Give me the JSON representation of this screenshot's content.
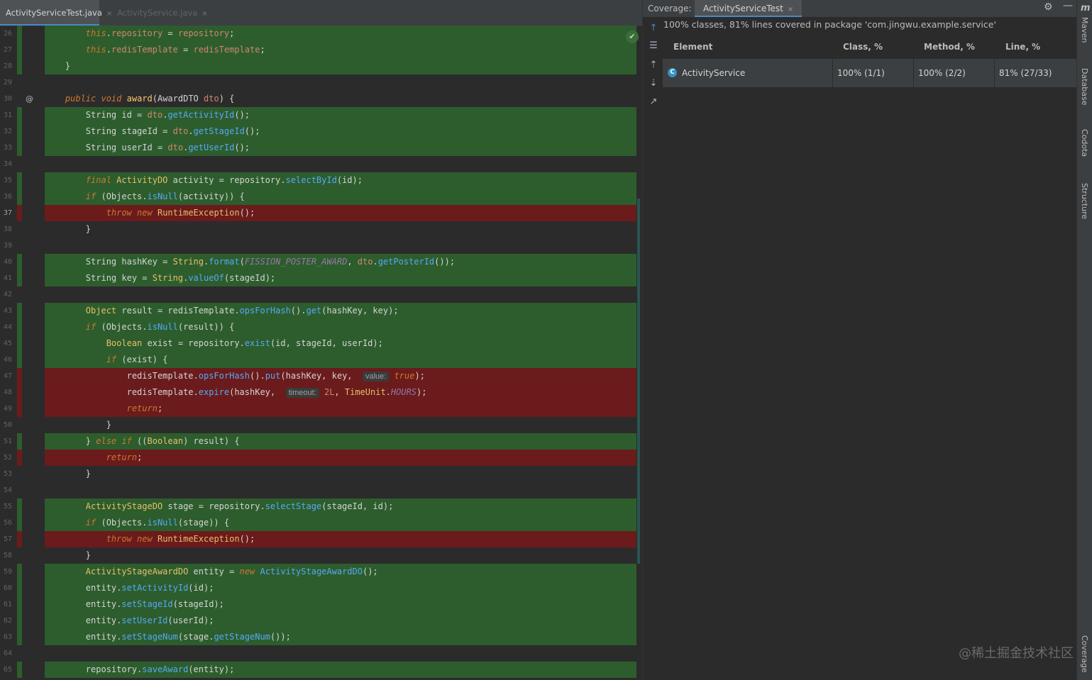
{
  "editor": {
    "tabs": [
      {
        "label": "ActivityServiceTest.java",
        "active": true
      },
      {
        "label": "ActivityService.java",
        "active": false
      }
    ],
    "close_glyph": "×"
  },
  "code_lines": [
    {
      "n": "26",
      "cov": "green",
      "html": "<span class='kw'>        this</span>.<span class='fld'>repository</span> = <span class='fld'>repository</span>;"
    },
    {
      "n": "27",
      "cov": "green",
      "html": "<span class='kw'>        this</span>.<span class='fld'>redisTemplate</span> = <span class='fld'>redisTemplate</span>;"
    },
    {
      "n": "28",
      "cov": "green",
      "html": "    }"
    },
    {
      "n": "29",
      "cov": "none",
      "html": ""
    },
    {
      "n": "30",
      "cov": "none",
      "at": true,
      "html": "    <span class='kw'>public void</span> <span class='fn'>award</span>(AwardDTO <span class='fld'>dto</span>) {"
    },
    {
      "n": "31",
      "cov": "green",
      "html": "        String id = <span class='fld'>dto</span>.<span class='mth'>getActivityId</span>();"
    },
    {
      "n": "32",
      "cov": "green",
      "html": "        String stageId = <span class='fld'>dto</span>.<span class='mth'>getStageId</span>();"
    },
    {
      "n": "33",
      "cov": "green",
      "html": "        String userId = <span class='fld'>dto</span>.<span class='mth'>getUserId</span>();"
    },
    {
      "n": "34",
      "cov": "none",
      "html": ""
    },
    {
      "n": "35",
      "cov": "green",
      "html": "        <span class='kw'>final</span> <span class='type'>ActivityDO</span> activity = repository.<span class='mth'>selectById</span>(id);"
    },
    {
      "n": "36",
      "cov": "green",
      "html": "        <span class='kw'>if</span> (Objects.<span class='mth'>isNull</span>(activity)) {"
    },
    {
      "n": "37",
      "cov": "red",
      "cur": true,
      "html": "            <span class='kw'>throw new</span> <span class='type'>RuntimeException</span>();"
    },
    {
      "n": "38",
      "cov": "none",
      "html": "        }"
    },
    {
      "n": "39",
      "cov": "none",
      "html": ""
    },
    {
      "n": "40",
      "cov": "green",
      "html": "        String hashKey = <span class='type'>String</span>.<span class='mth'>format</span>(<span class='cons'>FISSION_POSTER_AWARD</span>, <span class='fld'>dto</span>.<span class='mth'>getPosterId</span>());"
    },
    {
      "n": "41",
      "cov": "green",
      "html": "        String key = <span class='type'>String</span>.<span class='mth'>valueOf</span>(stageId);"
    },
    {
      "n": "42",
      "cov": "none",
      "html": ""
    },
    {
      "n": "43",
      "cov": "green",
      "html": "        <span class='type'>Object</span> result = redisTemplate.<span class='mth'>opsForHash</span>().<span class='mth'>get</span>(hashKey, key);"
    },
    {
      "n": "44",
      "cov": "green",
      "html": "        <span class='kw'>if</span> (Objects.<span class='mth'>isNull</span>(result)) {"
    },
    {
      "n": "45",
      "cov": "green",
      "html": "            <span class='type'>Boolean</span> exist = repository.<span class='mth'>exist</span>(id, stageId, userId);"
    },
    {
      "n": "46",
      "cov": "green",
      "html": "            <span class='kw'>if</span> (exist) {"
    },
    {
      "n": "47",
      "cov": "red",
      "html": "                redisTemplate.<span class='mth'>opsForHash</span>().<span class='mth'>put</span>(hashKey, key,  <span class='hint'>value:</span> <span class='kw'>true</span>);"
    },
    {
      "n": "48",
      "cov": "red",
      "html": "                redisTemplate.<span class='mth'>expire</span>(hashKey,  <span class='hint'>timeout:</span> <span class='fld'>2L</span>, <span class='type'>TimeUnit</span>.<span class='cons'>HOURS</span>);"
    },
    {
      "n": "49",
      "cov": "red",
      "html": "                <span class='kw'>return</span>;"
    },
    {
      "n": "50",
      "cov": "none",
      "html": "            }"
    },
    {
      "n": "51",
      "cov": "green",
      "html": "        } <span class='kw'>else if</span> ((<span class='type'>Boolean</span>) result) {"
    },
    {
      "n": "52",
      "cov": "red",
      "html": "            <span class='kw'>return</span>;"
    },
    {
      "n": "53",
      "cov": "none",
      "html": "        }"
    },
    {
      "n": "54",
      "cov": "none",
      "html": ""
    },
    {
      "n": "55",
      "cov": "green",
      "html": "        <span class='type'>ActivityStageDO</span> stage = repository.<span class='mth'>selectStage</span>(stageId, id);"
    },
    {
      "n": "56",
      "cov": "green",
      "html": "        <span class='kw'>if</span> (Objects.<span class='mth'>isNull</span>(stage)) {"
    },
    {
      "n": "57",
      "cov": "red",
      "html": "            <span class='kw'>throw new</span> <span class='type'>RuntimeException</span>();"
    },
    {
      "n": "58",
      "cov": "none",
      "html": "        }"
    },
    {
      "n": "59",
      "cov": "green",
      "html": "        <span class='type'>ActivityStageAwardDO</span> entity = <span class='kw'>new</span> <span class='mth'>ActivityStageAwardDO</span>();"
    },
    {
      "n": "60",
      "cov": "green",
      "html": "        entity.<span class='mth'>setActivityId</span>(id);"
    },
    {
      "n": "61",
      "cov": "green",
      "html": "        entity.<span class='mth'>setStageId</span>(stageId);"
    },
    {
      "n": "62",
      "cov": "green",
      "html": "        entity.<span class='mth'>setUserId</span>(userId);"
    },
    {
      "n": "63",
      "cov": "green",
      "html": "        entity.<span class='mth'>setStageNum</span>(stage.<span class='mth'>getStageNum</span>());"
    },
    {
      "n": "64",
      "cov": "none",
      "html": ""
    },
    {
      "n": "65",
      "cov": "green",
      "html": "        repository.<span class='mth'>saveAward</span>(entity);"
    }
  ],
  "coverage": {
    "label": "Coverage:",
    "tab": "ActivityServiceTest",
    "summary": "100% classes, 81% lines covered in package 'com.jingwu.example.service'",
    "columns": [
      "Element",
      "Class, %",
      "Method, %",
      "Line, %"
    ],
    "rows": [
      {
        "element": "ActivityService",
        "class_pct": "100% (1/1)",
        "method_pct": "100% (2/2)",
        "line_pct": "81% (27/33)"
      }
    ],
    "class_icon_letter": "C"
  },
  "side_tabs": [
    "Maven",
    "Database",
    "Codota",
    "Structure",
    "Coverage"
  ],
  "maven_glyph": "m",
  "watermark": "@稀土掘金技术社区",
  "icons": {
    "gear": "gear-icon",
    "minimize": "minimize-icon",
    "check": "check-icon"
  },
  "colors": {
    "covered": "#2d5d2d",
    "uncovered": "#6b1b1b",
    "accent": "#4a88c7"
  }
}
